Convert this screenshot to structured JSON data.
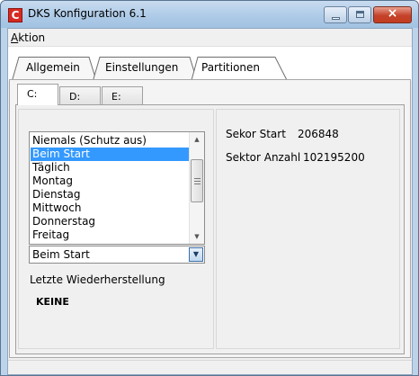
{
  "window": {
    "title": "DKS Konfiguration 6.1",
    "icon": "C",
    "accent": "#d62a22",
    "controls": {
      "minimize": "minimize-icon",
      "maximize": "maximize-icon",
      "close": "×"
    }
  },
  "menu": {
    "first_letter": "A",
    "rest": "ktion"
  },
  "tabs": [
    {
      "label": "Allgemein"
    },
    {
      "label": "Einstellungen"
    },
    {
      "label": "Partitionen",
      "active": true
    }
  ],
  "drive_tabs": [
    {
      "label": "C:",
      "active": true
    },
    {
      "label": "D:"
    },
    {
      "label": "E:"
    }
  ],
  "schedule": {
    "options": [
      "Niemals (Schutz aus)",
      "Beim Start",
      "Täglich",
      "Montag",
      "Dienstag",
      "Mittwoch",
      "Donnerstag",
      "Freitag"
    ],
    "selected": "Beim Start",
    "scroll_up": "▲",
    "scroll_down": "▼",
    "combo_arrow": "▼",
    "selection_color": "#3399ff"
  },
  "restore": {
    "label": "Letzte Wiederherstellung",
    "value": "KEINE"
  },
  "partition": {
    "start_label": "Sekor Start",
    "start_value": "206848",
    "count_label": "Sektor Anzahl",
    "count_value": "102195200"
  }
}
